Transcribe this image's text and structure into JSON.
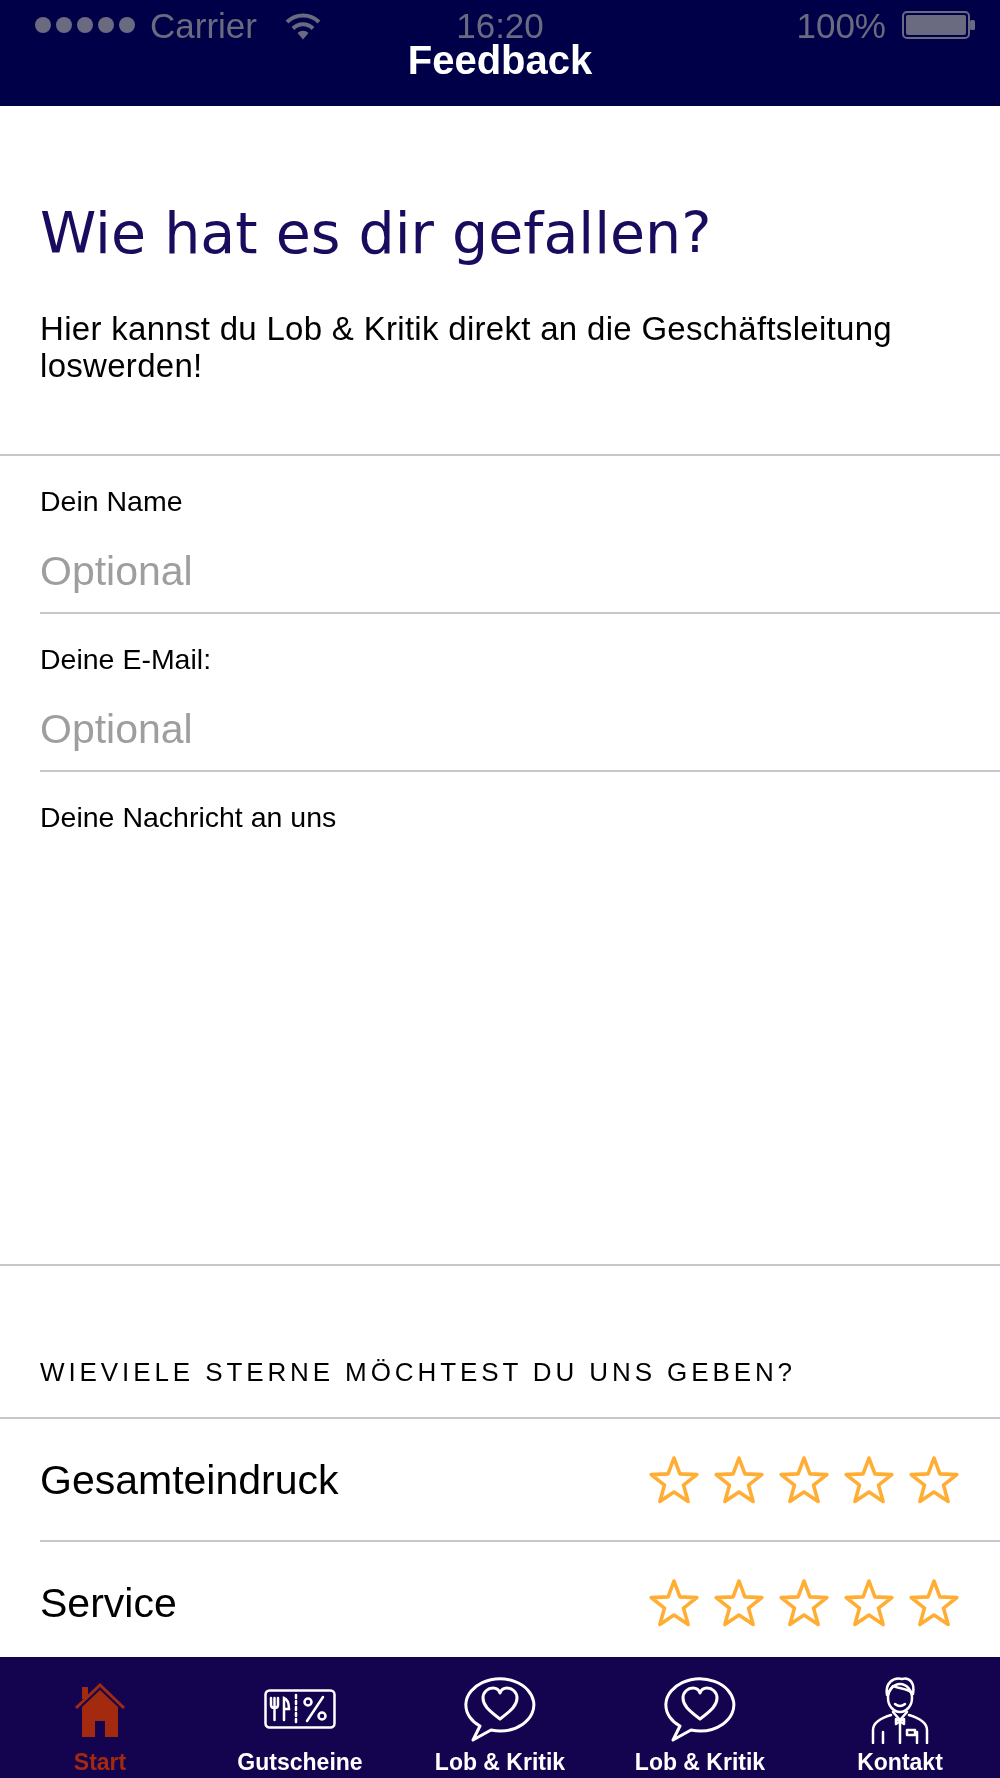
{
  "status_bar": {
    "carrier": "Carrier",
    "time": "16:20",
    "battery": "100%"
  },
  "nav_bar": {
    "title": "Feedback"
  },
  "intro": {
    "heading": "Wie hat es dir gefallen?",
    "text": "Hier kannst du Lob & Kritik direkt an die Geschäftsleitung loswerden!"
  },
  "form": {
    "fields": [
      {
        "kind": "text",
        "label": "Dein Name",
        "placeholder": "Optional"
      },
      {
        "kind": "text",
        "label": "Deine E-Mail:",
        "placeholder": "Optional"
      },
      {
        "kind": "textarea",
        "label": "Deine Nachricht an uns"
      }
    ]
  },
  "ratings": {
    "heading": "WIEVIELE STERNE MÖCHTEST DU UNS GEBEN?",
    "items": [
      {
        "label": "Gesamteindruck",
        "stars": 0
      },
      {
        "label": "Service",
        "stars": 0
      }
    ]
  },
  "tabs": [
    {
      "kind": "home",
      "label": "Start",
      "selected": true
    },
    {
      "kind": "voucher",
      "label": "Gutscheine",
      "selected": false
    },
    {
      "kind": "feedback",
      "label": "Lob & Kritik",
      "selected": false
    },
    {
      "kind": "feedback",
      "label": "Lob & Kritik",
      "selected": false
    },
    {
      "kind": "contact",
      "label": "Kontakt",
      "selected": false
    }
  ]
}
